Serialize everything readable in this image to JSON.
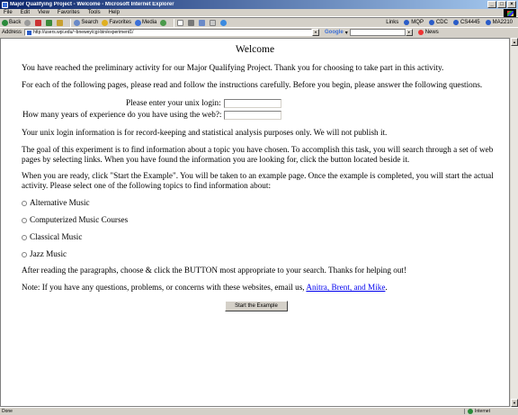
{
  "window": {
    "title": "Major Qualifying Project - Welcome - Microsoft Internet Explorer",
    "min": "_",
    "max": "□",
    "close": "×"
  },
  "menu": [
    "File",
    "Edit",
    "View",
    "Favorites",
    "Tools",
    "Help"
  ],
  "toolbar": {
    "back": "Back",
    "search": "Search",
    "favorites": "Favorites",
    "media": "Media",
    "links_label": "Links",
    "links": [
      "MQP",
      "CDC",
      "CS4445",
      "MA2210"
    ]
  },
  "address": {
    "label": "Address",
    "url": "http://users.wpi.edu/~bnewey/cgi-bin/experiment1/",
    "go_arrow": "▾"
  },
  "google": {
    "logo": "Google",
    "arrow": "▾",
    "news": "News"
  },
  "page": {
    "heading": "Welcome",
    "intro": "You have reached the preliminary activity for our Major Qualifying Project. Thank you for choosing to take part in this activity.",
    "instructions": "For each of the following pages, please read and follow the instructions carefully. Before you begin, please answer the following questions.",
    "login_label": "Please enter your unix login:",
    "experience_label": "How many years of experience do you have using the web?:",
    "privacy": "Your unix login information is for record-keeping and statistical analysis purposes only. We will not publish it.",
    "goal": "The goal of this experiment is to find information about a topic you have chosen. To accomplish this task, you will search through a set of web pages by selecting links. When you have found the information you are looking for, click the button located beside it.",
    "ready": "When you are ready, click \"Start the Example\". You will be taken to an example page. Once the example is completed, you will start the actual activity. Please select one of the following topics to find information about:",
    "topics": [
      "Alternative Music",
      "Computerized Music Courses",
      "Classical Music",
      "Jazz Music"
    ],
    "after": "After reading the paragraphs, choose & click the BUTTON most appropriate to your search. Thanks for helping out!",
    "note_prefix": "Note: If you have any questions, problems, or concerns with these websites, email us, ",
    "contact_link": "Anitra, Brent, and Mike",
    "note_suffix": ".",
    "start_button": "Start the Example"
  },
  "status": {
    "left": "Done",
    "zone": "Internet"
  }
}
